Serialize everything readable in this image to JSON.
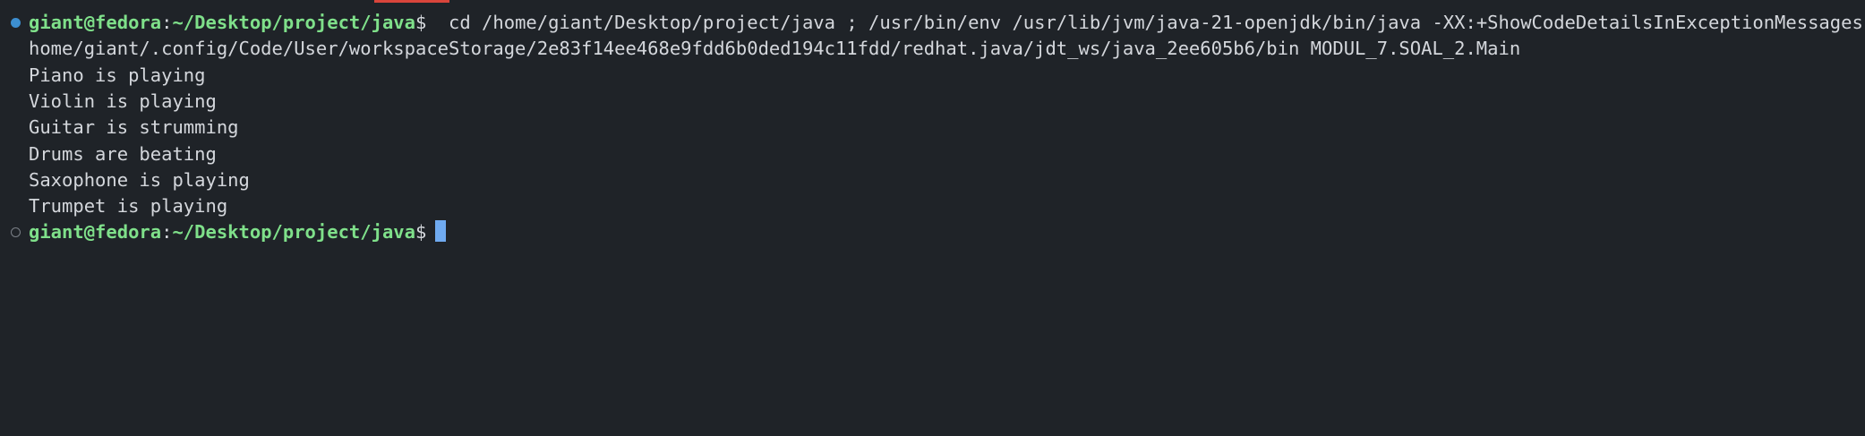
{
  "prompt": {
    "user_host": "giant@fedora",
    "colon": ":",
    "path": "~/Desktop/project/java",
    "symbol": "$"
  },
  "command": {
    "line1": "  cd /home/giant/Desktop/project/java ; /usr/bin/env /usr/lib/jvm/java-21-openjdk/bin/java -XX:+ShowCodeDetailsInExceptionMessages -cp",
    "line2": "home/giant/.config/Code/User/workspaceStorage/2e83f14ee468e9fdd6b0ded194c11fdd/redhat.java/jdt_ws/java_2ee605b6/bin MODUL_7.SOAL_2.Main"
  },
  "output": [
    "Piano is playing",
    "Violin is playing",
    "Guitar is strumming",
    "Drums are beating",
    "Saxophone is playing",
    "Trumpet is playing"
  ],
  "markers": {
    "first_command": "success-dot",
    "second_command": "pending-circle"
  },
  "colors": {
    "background": "#1f2328",
    "prompt_green": "#7fe08a",
    "text": "#d4d7dc",
    "cursor": "#6faaf0",
    "success_marker": "#3d8fd1",
    "accent_bar": "#d9453b"
  }
}
